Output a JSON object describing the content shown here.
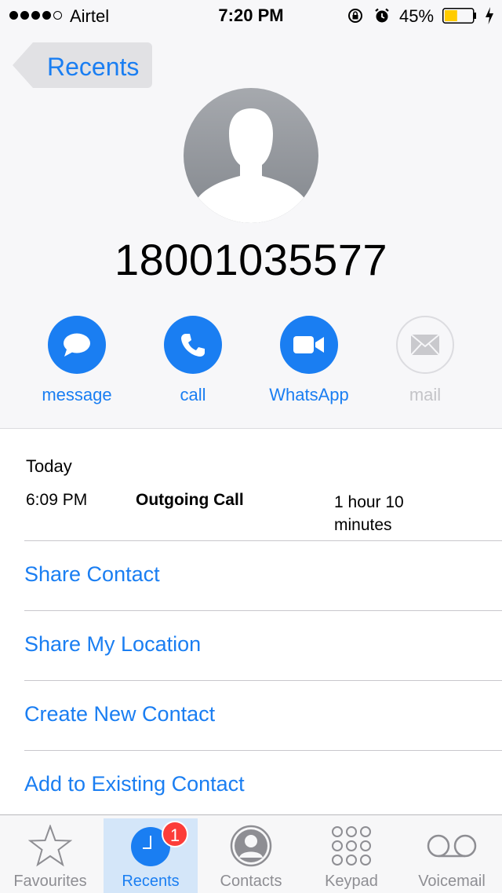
{
  "status_bar": {
    "carrier": "Airtel",
    "time": "7:20 PM",
    "battery_percent": "45%",
    "battery_level": 0.45,
    "signal_bars": 4,
    "signal_total": 5
  },
  "nav": {
    "back_label": "Recents"
  },
  "contact": {
    "number": "18001035577"
  },
  "actions": [
    {
      "label": "message",
      "icon": "message-icon",
      "enabled": true
    },
    {
      "label": "call",
      "icon": "phone-icon",
      "enabled": true
    },
    {
      "label": "WhatsApp",
      "icon": "video-icon",
      "enabled": true
    },
    {
      "label": "mail",
      "icon": "mail-icon",
      "enabled": false
    }
  ],
  "call_log": {
    "day": "Today",
    "entries": [
      {
        "time": "6:09 PM",
        "type": "Outgoing Call",
        "duration": "1 hour 10 minutes"
      }
    ]
  },
  "options": [
    "Share Contact",
    "Share My Location",
    "Create New Contact",
    "Add to Existing Contact"
  ],
  "tabs": [
    {
      "label": "Favourites",
      "icon": "star-icon",
      "active": false
    },
    {
      "label": "Recents",
      "icon": "clock-icon",
      "active": true,
      "badge": "1"
    },
    {
      "label": "Contacts",
      "icon": "contacts-icon",
      "active": false
    },
    {
      "label": "Keypad",
      "icon": "keypad-icon",
      "active": false
    },
    {
      "label": "Voicemail",
      "icon": "voicemail-icon",
      "active": false
    }
  ],
  "colors": {
    "accent": "#1a7ef2",
    "badge": "#fc3d39",
    "battery_fill": "#ffcc00"
  }
}
